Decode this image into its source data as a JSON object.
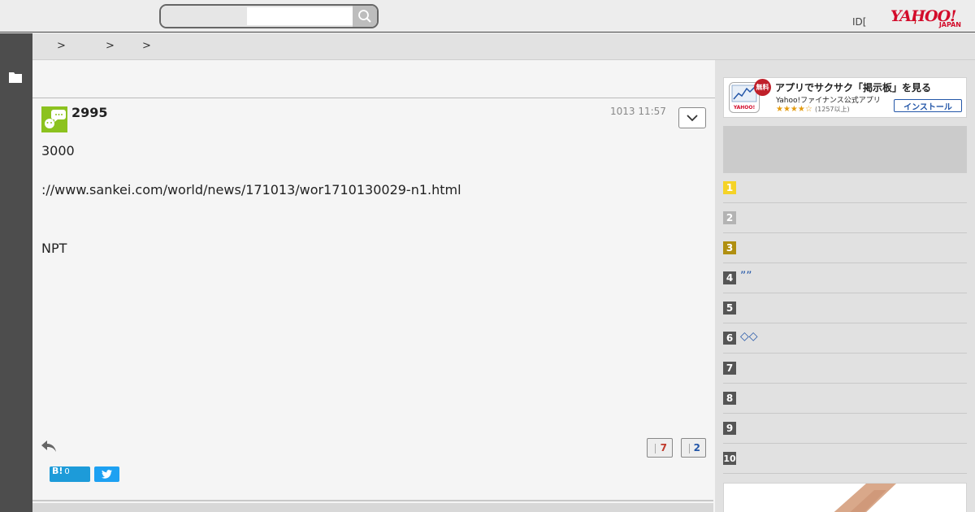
{
  "header": {
    "search": {
      "placeholder": "",
      "value": ""
    },
    "id_link": "ID[",
    "login_mark": "]",
    "logo": {
      "text": "YAHOO!",
      "sub": "JAPAN"
    }
  },
  "breadcrumb": [
    ">",
    ">",
    ">"
  ],
  "post": {
    "number": "2995",
    "timestamp": "1013 11:57",
    "body": [
      "3000",
      "",
      "://www.sankei.com/world/news/171013/wor1710130029-n1.html",
      "",
      "",
      "NPT"
    ],
    "likes": "7",
    "dislikes": "2",
    "hatena_label": "B!",
    "hatena_count": "0"
  },
  "sidebar": {
    "app_ad": {
      "free_badge": "無料",
      "title": "アプリでサクサク「掲示板」を見る",
      "subtitle": "Yahoo!ファイナンス公式アプリ",
      "stars": "★★★★☆",
      "rating_count": "(1257以上)",
      "install_label": "インストール"
    },
    "ranking": [
      {
        "rank": "1",
        "label": ""
      },
      {
        "rank": "2",
        "label": ""
      },
      {
        "rank": "3",
        "label": ""
      },
      {
        "rank": "4",
        "label": "””"
      },
      {
        "rank": "5",
        "label": ""
      },
      {
        "rank": "6",
        "label": "◇◇"
      },
      {
        "rank": "7",
        "label": ""
      },
      {
        "rank": "8",
        "label": ""
      },
      {
        "rank": "9",
        "label": ""
      },
      {
        "rank": "10",
        "label": ""
      }
    ]
  },
  "colors": {
    "brand": "#d30c2b",
    "link": "#2356a8",
    "avatar_bg": "#8cc21f",
    "like": "#c0392b",
    "dislike": "#2356a8",
    "rank1": "#f5d327",
    "rank2": "#b3b3b3",
    "rank3": "#b08f10"
  }
}
